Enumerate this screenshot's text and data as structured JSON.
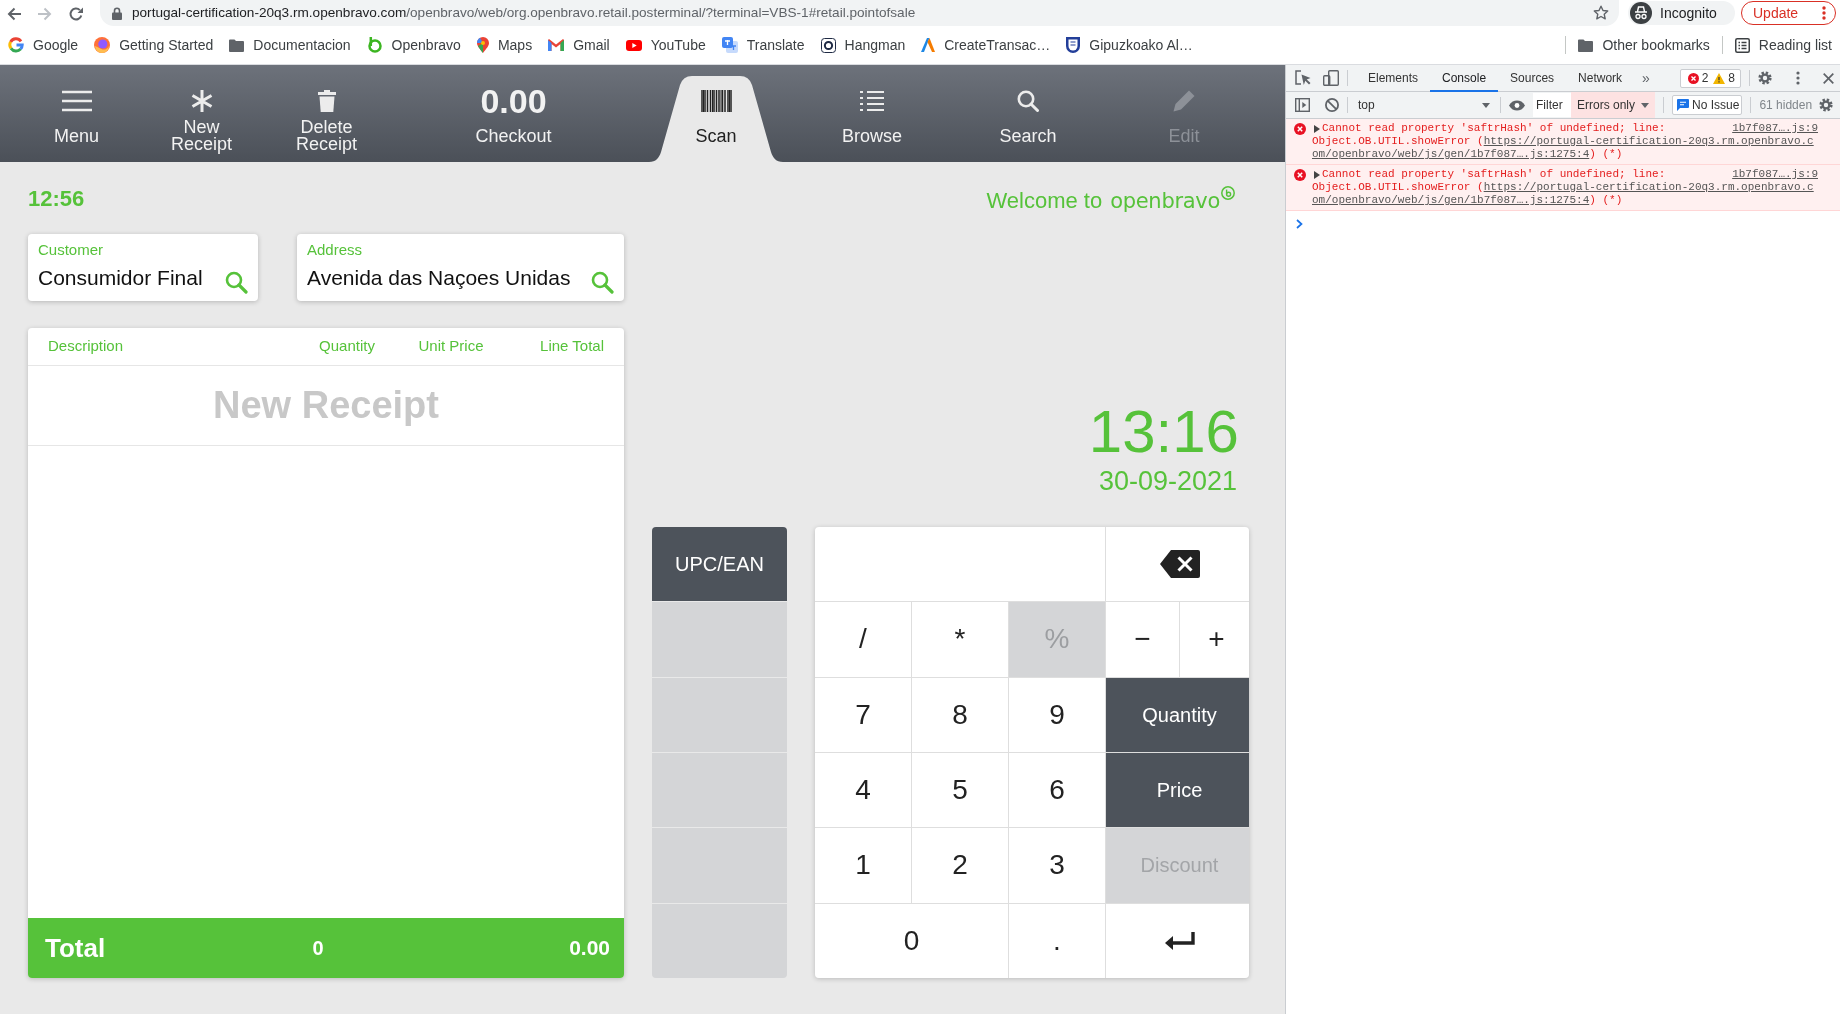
{
  "browser": {
    "nav": [
      {
        "kind": "back",
        "disabled": false
      },
      {
        "kind": "forward",
        "disabled": true
      },
      {
        "kind": "reload",
        "disabled": false
      }
    ],
    "url": {
      "host": "portugal-certification-20q3.rm.openbravo.com",
      "path": "/openbravo/web/org.openbravo.retail.posterminal/?terminal=VBS-1#retail.pointofsale"
    },
    "profile": "Incognito",
    "update": "Update",
    "bookmarks": [
      {
        "label": "Google",
        "kind": "google"
      },
      {
        "label": "Getting Started",
        "kind": "firefox"
      },
      {
        "label": "Documentacion",
        "kind": "folder"
      },
      {
        "label": "Openbravo",
        "kind": "openbravo"
      },
      {
        "label": "Maps",
        "kind": "maps"
      },
      {
        "label": "Gmail",
        "kind": "gmail"
      },
      {
        "label": "YouTube",
        "kind": "youtube"
      },
      {
        "label": "Translate",
        "kind": "translate"
      },
      {
        "label": "Hangman",
        "kind": "hangman"
      },
      {
        "label": "CreateTransac…",
        "kind": "create"
      },
      {
        "label": "Gipuzkoako Al…",
        "kind": "shield"
      }
    ],
    "other_bookmarks": "Other bookmarks",
    "reading_list": "Reading list"
  },
  "pos": {
    "toolbar": [
      {
        "kind": "menu",
        "label": "Menu",
        "selected": false,
        "disabled": false
      },
      {
        "kind": "new",
        "label": "New Receipt",
        "selected": false,
        "disabled": false
      },
      {
        "kind": "delete",
        "label": "Delete Receipt",
        "selected": false,
        "disabled": false
      },
      {
        "kind": "checkout",
        "amount": "0.00",
        "label": "Checkout",
        "selected": false,
        "disabled": false
      },
      {
        "kind": "scan",
        "label": "Scan",
        "selected": true,
        "disabled": false
      },
      {
        "kind": "browse",
        "label": "Browse",
        "selected": false,
        "disabled": false
      },
      {
        "kind": "search",
        "label": "Search",
        "selected": false,
        "disabled": false
      },
      {
        "kind": "edit",
        "label": "Edit",
        "selected": false,
        "disabled": true
      }
    ],
    "session_time": "12:56",
    "customer": {
      "label": "Customer",
      "value": "Consumidor Final"
    },
    "address": {
      "label": "Address",
      "value": "Avenida das Naçoes Unidas"
    },
    "receipt": {
      "columns": [
        "Description",
        "Quantity",
        "Unit Price",
        "Line Total"
      ],
      "title": "New Receipt",
      "total": {
        "label": "Total",
        "quantity": "0",
        "amount": "0.00"
      }
    },
    "welcome": {
      "text": "Welcome to",
      "brand": "openbravo"
    },
    "clock": {
      "time": "13:16",
      "date": "30-09-2021"
    },
    "scan_modes": [
      {
        "label": "UPC/EAN"
      }
    ],
    "keypad": [
      {
        "kind": "display"
      },
      {
        "kind": "backspace",
        "disabled": false
      },
      {
        "kind": "key",
        "label": "/",
        "disabled": false
      },
      {
        "kind": "key",
        "label": "*",
        "disabled": false
      },
      {
        "kind": "key",
        "label": "%",
        "disabled": true
      },
      {
        "kind": "small_key",
        "label": "−",
        "disabled": false
      },
      {
        "kind": "small_key",
        "label": "+",
        "disabled": false
      },
      {
        "kind": "key",
        "label": "7",
        "disabled": false
      },
      {
        "kind": "key",
        "label": "8",
        "disabled": false
      },
      {
        "kind": "key",
        "label": "9",
        "disabled": false
      },
      {
        "kind": "action",
        "label": "Quantity",
        "disabled": false
      },
      {
        "kind": "key",
        "label": "4",
        "disabled": false
      },
      {
        "kind": "key",
        "label": "5",
        "disabled": false
      },
      {
        "kind": "key",
        "label": "6",
        "disabled": false
      },
      {
        "kind": "action",
        "label": "Price",
        "disabled": false
      },
      {
        "kind": "key",
        "label": "1",
        "disabled": false
      },
      {
        "kind": "key",
        "label": "2",
        "disabled": false
      },
      {
        "kind": "key",
        "label": "3",
        "disabled": false
      },
      {
        "kind": "action",
        "label": "Discount",
        "disabled": true
      },
      {
        "kind": "wide_key",
        "label": "0",
        "disabled": false
      },
      {
        "kind": "key",
        "label": ".",
        "disabled": false
      },
      {
        "kind": "enter",
        "disabled": false
      }
    ]
  },
  "devtools": {
    "tabs": [
      {
        "label": "Elements",
        "selected": false
      },
      {
        "label": "Console",
        "selected": true
      },
      {
        "label": "Sources",
        "selected": false
      },
      {
        "label": "Network",
        "selected": false
      }
    ],
    "more_tabs": "»",
    "error_count": "2",
    "warning_count": "8",
    "context": "top",
    "filter_placeholder": "Filter",
    "level_filter": "Errors only",
    "issues": "No Issue",
    "hidden": "61 hidden",
    "messages": [
      {
        "text": "Cannot read property 'saftrHash' of undefined; line:",
        "source": "1b7f087….js:9",
        "stack": [
          {
            "prefix": "Object.OB.UTIL.showError (",
            "link": "https://portugal-certification-20q3.rm.openbravo.c"
          },
          {
            "link": "om/openbravo/web/js/gen/1b7f087….js:1275:4",
            "suffix": ") (*)"
          }
        ]
      },
      {
        "text": "Cannot read property 'saftrHash' of undefined; line:",
        "source": "1b7f087….js:9",
        "stack": [
          {
            "prefix": "Object.OB.UTIL.showError (",
            "link": "https://portugal-certification-20q3.rm.openbravo.c"
          },
          {
            "link": "om/openbravo/web/js/gen/1b7f087….js:1275:4",
            "suffix": ") (*)"
          }
        ]
      }
    ]
  }
}
